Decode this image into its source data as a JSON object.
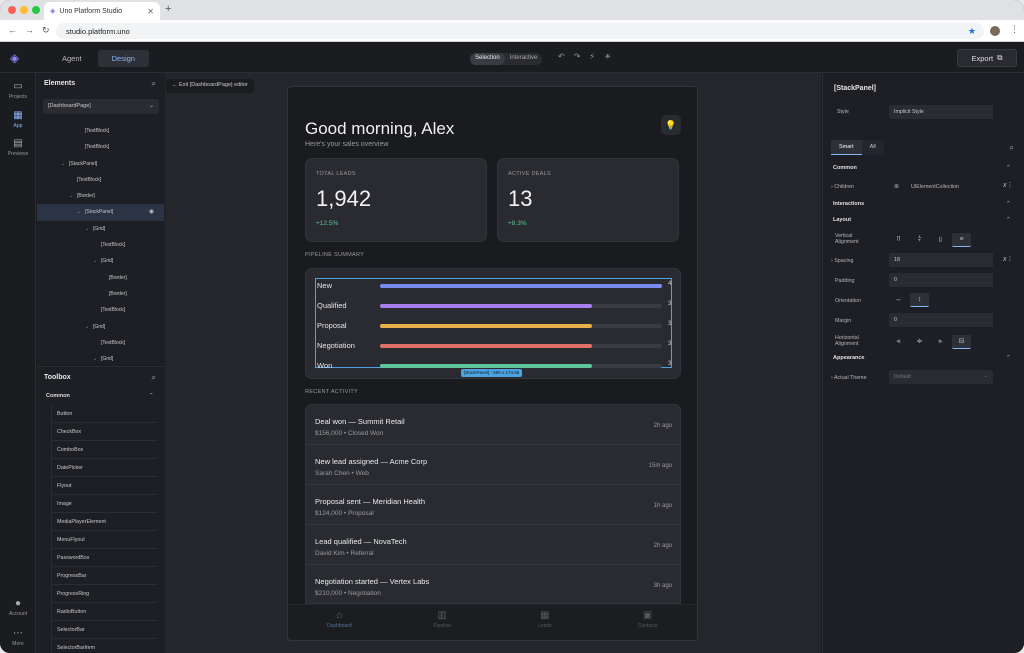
{
  "browser": {
    "tab_title": "Uno Platform Studio",
    "url": "studio.platform.uno"
  },
  "header": {
    "tabs": [
      {
        "label": "Agent"
      },
      {
        "label": "Design"
      }
    ],
    "mode_selection": "Selection",
    "mode_interactive": "Interactive",
    "export_label": "Export"
  },
  "rail": {
    "items": [
      {
        "label": "Projects"
      },
      {
        "label": "App"
      },
      {
        "label": "Previews"
      }
    ],
    "account": "Account",
    "more": "More"
  },
  "elements": {
    "title": "Elements",
    "page": "[DashboardPage]",
    "tree": [
      {
        "label": "[TextBlock]",
        "indent": 5,
        "twisty": ""
      },
      {
        "label": "[TextBlock]",
        "indent": 5,
        "twisty": ""
      },
      {
        "label": "[StackPanel]",
        "indent": 3,
        "twisty": "⌄"
      },
      {
        "label": "[TextBlock]",
        "indent": 4,
        "twisty": ""
      },
      {
        "label": "[Border]",
        "indent": 4,
        "twisty": "⌄"
      },
      {
        "label": "[StackPanel]",
        "indent": 5,
        "twisty": "⌄",
        "selected": true
      },
      {
        "label": "[Grid]",
        "indent": 6,
        "twisty": "⌄"
      },
      {
        "label": "[TextBlock]",
        "indent": 7,
        "twisty": ""
      },
      {
        "label": "[Grid]",
        "indent": 7,
        "twisty": "⌄"
      },
      {
        "label": "[Border]",
        "indent": 8,
        "twisty": ""
      },
      {
        "label": "[Border]",
        "indent": 8,
        "twisty": ""
      },
      {
        "label": "[TextBlock]",
        "indent": 7,
        "twisty": ""
      },
      {
        "label": "[Grid]",
        "indent": 6,
        "twisty": "⌄"
      },
      {
        "label": "[TextBlock]",
        "indent": 7,
        "twisty": ""
      },
      {
        "label": "[Grid]",
        "indent": 7,
        "twisty": "⌄"
      }
    ]
  },
  "toolbox": {
    "title": "Toolbox",
    "section": "Common",
    "items": [
      "Button",
      "CheckBox",
      "ComboBox",
      "DatePicker",
      "Flyout",
      "Image",
      "MediaPlayerElement",
      "MenuFlyout",
      "PasswordBox",
      "ProgressBar",
      "ProgressRing",
      "RadioButton",
      "SelectorBar",
      "SelectorBarItem"
    ]
  },
  "canvas": {
    "exit_label": "Exit [DashboardPage] editor",
    "selection_badge": "[StackPanel] · 690 x 174.56"
  },
  "dashboard": {
    "greeting": "Good morning, Alex",
    "subtitle": "Here's your sales overview",
    "stats": [
      {
        "label": "TOTAL LEADS",
        "value": "1,942",
        "change": "+12.5%"
      },
      {
        "label": "ACTIVE DEALS",
        "value": "13",
        "change": "+8.3%"
      }
    ],
    "pipeline_title": "PIPELINE SUMMARY",
    "pipeline": [
      {
        "label": "New",
        "value": "4",
        "fraction": 1.0,
        "color": "#7b8cf0"
      },
      {
        "label": "Qualified",
        "value": "3",
        "fraction": 0.75,
        "color": "#a57ef0"
      },
      {
        "label": "Proposal",
        "value": "3",
        "fraction": 0.75,
        "color": "#e8b14a"
      },
      {
        "label": "Negotiation",
        "value": "3",
        "fraction": 0.75,
        "color": "#e0726a"
      },
      {
        "label": "Won",
        "value": "3",
        "fraction": 0.75,
        "color": "#5ec59a"
      }
    ],
    "activity_title": "RECENT ACTIVITY",
    "activity": [
      {
        "title": "Deal won — Summit Retail",
        "sub": "$156,000  •  Closed Won",
        "ago": "2h ago"
      },
      {
        "title": "New lead assigned — Acme Corp",
        "sub": "Sarah Chen  •  Web",
        "ago": "15m ago"
      },
      {
        "title": "Proposal sent — Meridian Health",
        "sub": "$124,000  •  Proposal",
        "ago": "1h ago"
      },
      {
        "title": "Lead qualified — NovaTech",
        "sub": "David Kim  •  Referral",
        "ago": "2h ago"
      },
      {
        "title": "Negotiation started — Vertex Labs",
        "sub": "$210,000  •  Negotiation",
        "ago": "3h ago"
      }
    ],
    "bottom_nav": [
      "Dashboard",
      "Pipeline",
      "Leads",
      "Contacts"
    ]
  },
  "properties": {
    "type": "[StackPanel]",
    "style_label": "Style",
    "style_value": "Implicit Style",
    "filter_smart": "Smart",
    "filter_all": "All",
    "sec_common": "Common",
    "children_label": "Children",
    "children_value": "UIElementCollection",
    "sec_interactions": "Interactions",
    "sec_layout": "Layout",
    "vertical_alignment_label": "Vertical Alignment",
    "spacing_label": "Spacing",
    "spacing_value": "18",
    "padding_label": "Padding",
    "padding_value": "0",
    "orientation_label": "Orientation",
    "margin_label": "Margin",
    "margin_value": "0",
    "horizontal_alignment_label": "Horizontal Alignment",
    "sec_appearance": "Appearance",
    "actual_theme_label": "Actual Theme",
    "actual_theme_value": "Default"
  }
}
